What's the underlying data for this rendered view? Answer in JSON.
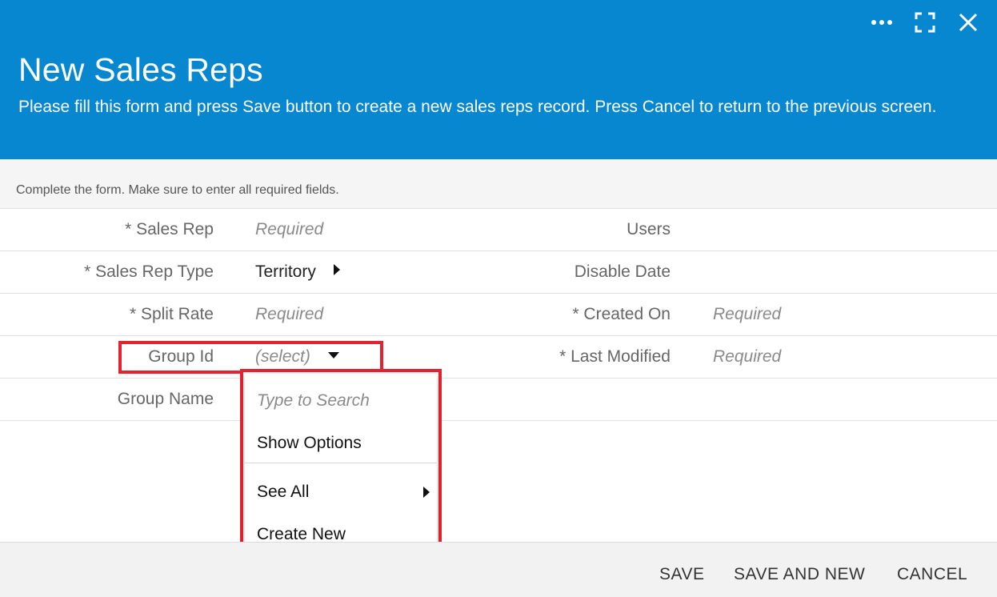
{
  "header": {
    "title": "New Sales Reps",
    "subtitle": "Please fill this form and press Save button to create a new sales reps record. Press Cancel to return to the previous screen.",
    "background_color": "#0787d0",
    "controls": [
      "more-icon",
      "maximize-icon",
      "close-icon"
    ]
  },
  "instructions": "Complete the form. Make sure to enter all required fields.",
  "form": {
    "rows": [
      {
        "left_label": "* Sales Rep",
        "left_value": "Required",
        "right_label": "Users",
        "right_value": ""
      },
      {
        "left_label": "* Sales Rep Type",
        "left_value": "Territory",
        "right_label": "Disable Date",
        "right_value": ""
      },
      {
        "left_label": "* Split Rate",
        "left_value": "Required",
        "right_label": "* Created On",
        "right_value": "Required"
      },
      {
        "left_label": "Group Id",
        "left_value": "(select)",
        "right_label": "* Last Modified",
        "right_value": "Required"
      },
      {
        "left_label": "Group Name",
        "left_value": "",
        "right_label": "",
        "right_value": ""
      }
    ]
  },
  "dropdown": {
    "search_placeholder": "Type to Search",
    "show_options": "Show Options",
    "see_all": "See All",
    "create_new": "Create New"
  },
  "footer": {
    "save": "SAVE",
    "save_and_new": "SAVE AND NEW",
    "cancel": "CANCEL"
  },
  "highlight_color": "#e3232f"
}
